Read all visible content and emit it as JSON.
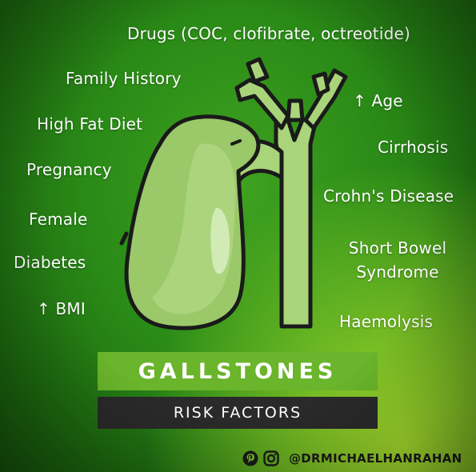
{
  "risk_factors_top": {
    "drugs": "Drugs (COC, clofibrate, octreotide)"
  },
  "risk_factors_left": [
    "Family History",
    "High Fat Diet",
    "Pregnancy",
    "Female",
    "Diabetes",
    "↑ BMI"
  ],
  "risk_factors_right": [
    "↑ Age",
    "Cirrhosis",
    "Crohn's Disease",
    "Short Bowel Syndrome",
    "Haemolysis"
  ],
  "risk_factors_right_lines": {
    "short_bowel_line1": "Short Bowel",
    "short_bowel_line2": "Syndrome"
  },
  "title": "GALLSTONES",
  "subtitle": "RISK FACTORS",
  "footer": {
    "handle": "@DRMICHAELHANRAHAN",
    "icons": [
      "pinterest-icon",
      "instagram-icon"
    ]
  },
  "colors": {
    "title_banner": "#6ab52b",
    "subtitle_banner": "#2a2a2a",
    "gallbladder_fill": "#9bc96a",
    "duct_fill": "#a9d47a",
    "outline": "#1a1a1a"
  }
}
